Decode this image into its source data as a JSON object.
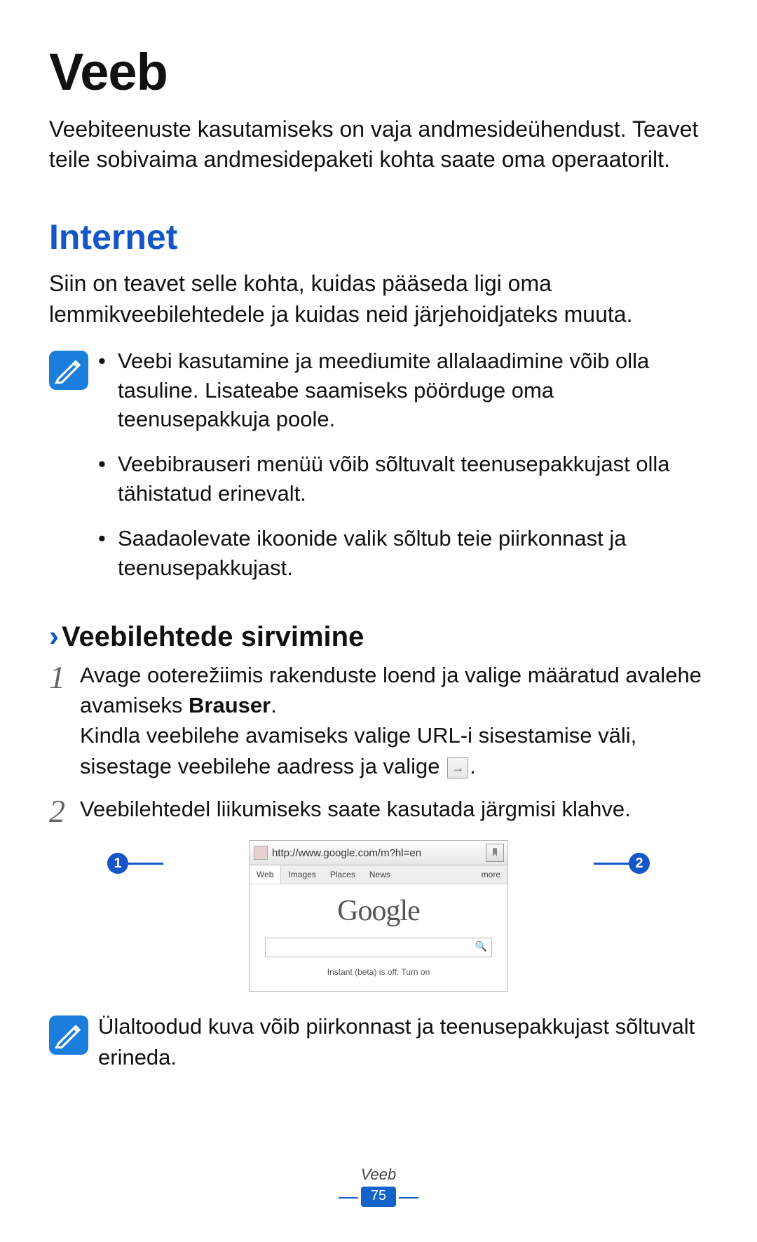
{
  "title": "Veeb",
  "intro": "Veebiteenuste kasutamiseks on vaja andmesideühendust. Teavet teile sobivaima andmesidepaketi kohta saate oma operaatorilt.",
  "section": {
    "heading": "Internet",
    "intro": "Siin on teavet selle kohta, kuidas pääseda ligi oma lemmikveebilehtedele ja kuidas neid järjehoidjateks muuta.",
    "notes": [
      "Veebi kasutamine ja meediumite allalaadimine võib olla tasuline. Lisateabe saamiseks pöörduge oma teenusepakkuja poole.",
      "Veebibrauseri menüü võib sõltuvalt teenusepakkujast olla tähistatud erinevalt.",
      "Saadaolevate ikoonide valik sõltub teie piirkonnast ja teenusepakkujast."
    ]
  },
  "subheading": "Veebilehtede sirvimine",
  "steps": {
    "s1": {
      "num": "1",
      "pre": "Avage ooterežiimis rakenduste loend ja valige määratud avalehe avamiseks ",
      "bold": "Brauser",
      "post": ".",
      "line2_pre": "Kindla veebilehe avamiseks valige URL-i sisestamise väli, sisestage veebilehe aadress ja valige ",
      "line2_post": "."
    },
    "s2": {
      "num": "2",
      "text": "Veebilehtedel liikumiseks saate kasutada järgmisi klahve."
    }
  },
  "mock": {
    "url": "http://www.google.com/m?hl=en",
    "tabs": {
      "web": "Web",
      "images": "Images",
      "places": "Places",
      "news": "News",
      "more": "more"
    },
    "logo": "Google",
    "instant": "Instant (beta) is off: Turn on"
  },
  "callouts": {
    "c1": "1",
    "c2": "2"
  },
  "bottom_note": "Ülaltoodud kuva võib piirkonnast ja teenusepakkujast sõltuvalt erineda.",
  "footer": {
    "label": "Veeb",
    "page": "75"
  }
}
